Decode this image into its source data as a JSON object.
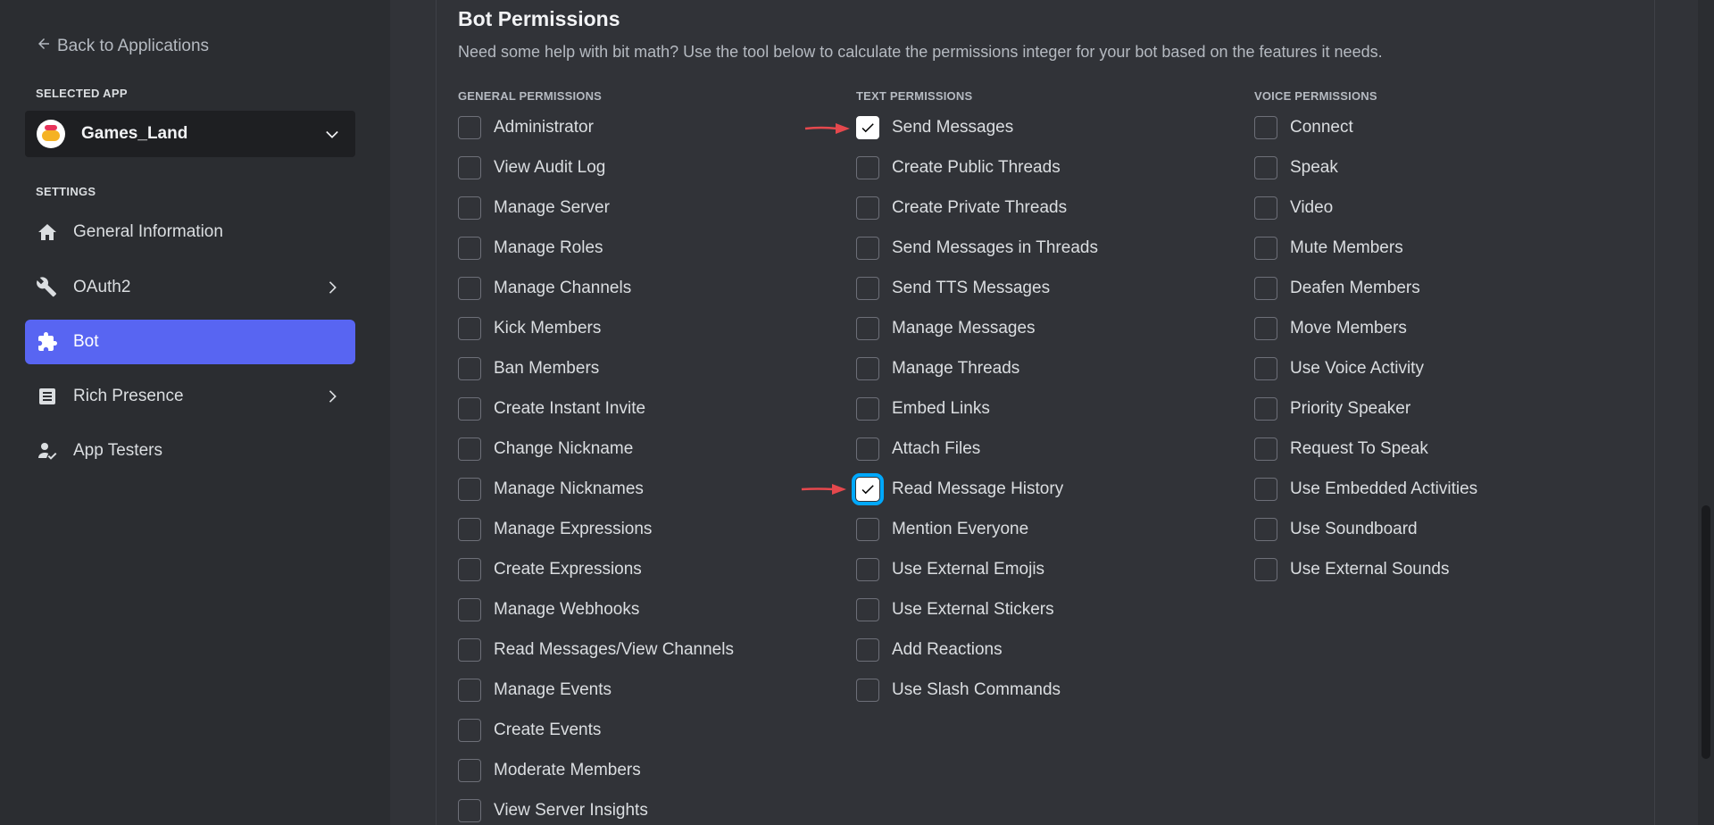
{
  "sidebar": {
    "back_label": "Back to Applications",
    "selected_app_heading": "SELECTED APP",
    "app_name": "Games_Land",
    "settings_heading": "SETTINGS",
    "items": [
      {
        "label": "General Information",
        "icon": "home-icon"
      },
      {
        "label": "OAuth2",
        "icon": "wrench-icon"
      },
      {
        "label": "Bot",
        "icon": "puzzle-icon"
      },
      {
        "label": "Rich Presence",
        "icon": "document-icon"
      },
      {
        "label": "App Testers",
        "icon": "user-icon"
      }
    ],
    "active_item": "Bot",
    "accent_color": "#5865f2"
  },
  "main": {
    "title": "Bot Permissions",
    "description": "Need some help with bit math? Use the tool below to calculate the permissions integer for your bot based on the features it needs.",
    "columns": {
      "general": {
        "heading": "GENERAL PERMISSIONS",
        "items": [
          {
            "label": "Administrator",
            "checked": false
          },
          {
            "label": "View Audit Log",
            "checked": false
          },
          {
            "label": "Manage Server",
            "checked": false
          },
          {
            "label": "Manage Roles",
            "checked": false
          },
          {
            "label": "Manage Channels",
            "checked": false
          },
          {
            "label": "Kick Members",
            "checked": false
          },
          {
            "label": "Ban Members",
            "checked": false
          },
          {
            "label": "Create Instant Invite",
            "checked": false
          },
          {
            "label": "Change Nickname",
            "checked": false
          },
          {
            "label": "Manage Nicknames",
            "checked": false
          },
          {
            "label": "Manage Expressions",
            "checked": false
          },
          {
            "label": "Create Expressions",
            "checked": false
          },
          {
            "label": "Manage Webhooks",
            "checked": false
          },
          {
            "label": "Read Messages/View Channels",
            "checked": false
          },
          {
            "label": "Manage Events",
            "checked": false
          },
          {
            "label": "Create Events",
            "checked": false
          },
          {
            "label": "Moderate Members",
            "checked": false
          },
          {
            "label": "View Server Insights",
            "checked": false
          }
        ]
      },
      "text": {
        "heading": "TEXT PERMISSIONS",
        "items": [
          {
            "label": "Send Messages",
            "checked": true
          },
          {
            "label": "Create Public Threads",
            "checked": false
          },
          {
            "label": "Create Private Threads",
            "checked": false
          },
          {
            "label": "Send Messages in Threads",
            "checked": false
          },
          {
            "label": "Send TTS Messages",
            "checked": false
          },
          {
            "label": "Manage Messages",
            "checked": false
          },
          {
            "label": "Manage Threads",
            "checked": false
          },
          {
            "label": "Embed Links",
            "checked": false
          },
          {
            "label": "Attach Files",
            "checked": false
          },
          {
            "label": "Read Message History",
            "checked": true
          },
          {
            "label": "Mention Everyone",
            "checked": false
          },
          {
            "label": "Use External Emojis",
            "checked": false
          },
          {
            "label": "Use External Stickers",
            "checked": false
          },
          {
            "label": "Add Reactions",
            "checked": false
          },
          {
            "label": "Use Slash Commands",
            "checked": false
          }
        ]
      },
      "voice": {
        "heading": "VOICE PERMISSIONS",
        "items": [
          {
            "label": "Connect",
            "checked": false
          },
          {
            "label": "Speak",
            "checked": false
          },
          {
            "label": "Video",
            "checked": false
          },
          {
            "label": "Mute Members",
            "checked": false
          },
          {
            "label": "Deafen Members",
            "checked": false
          },
          {
            "label": "Move Members",
            "checked": false
          },
          {
            "label": "Use Voice Activity",
            "checked": false
          },
          {
            "label": "Priority Speaker",
            "checked": false
          },
          {
            "label": "Request To Speak",
            "checked": false
          },
          {
            "label": "Use Embedded Activities",
            "checked": false
          },
          {
            "label": "Use Soundboard",
            "checked": false
          },
          {
            "label": "Use External Sounds",
            "checked": false
          }
        ]
      }
    },
    "focused_item": "Read Message History",
    "annotation_color": "#e5484d"
  }
}
